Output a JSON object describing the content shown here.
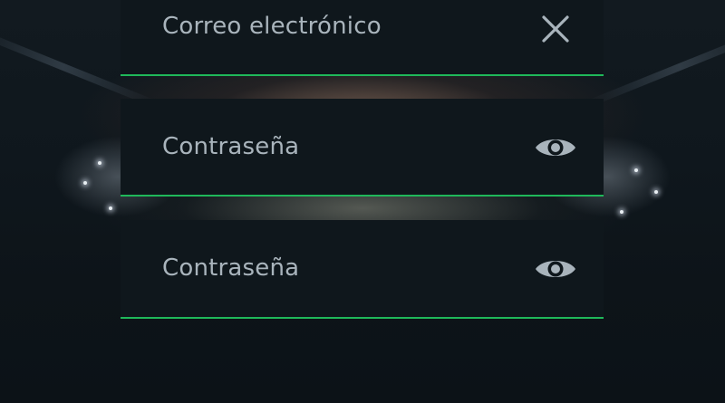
{
  "form": {
    "email_field": {
      "placeholder": "Correo electrónico",
      "action_icon": "close-icon"
    },
    "password_field": {
      "placeholder": "Contraseña",
      "action_icon": "eye-icon"
    },
    "confirm_password_field": {
      "placeholder": "Contraseña",
      "action_icon": "eye-icon"
    }
  },
  "colors": {
    "field_background": "#0f171c",
    "field_text": "#a9b4bc",
    "accent_underline": "#1fb85a",
    "icon": "#a9b4bc"
  }
}
